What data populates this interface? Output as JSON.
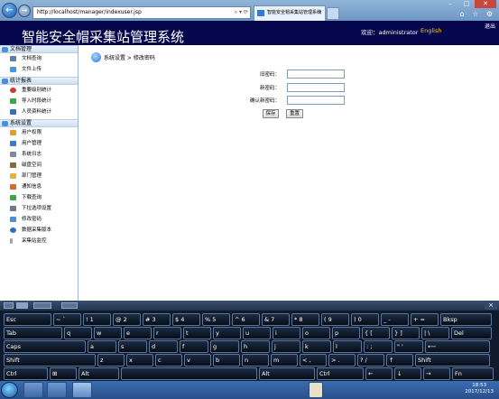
{
  "browser": {
    "url": "http://localhost/manager/indexuser.jsp",
    "tab_title": "智能安全帽采集站管理系统",
    "tab_close": "×"
  },
  "header": {
    "title": "智能安全帽采集站管理系统",
    "welcome": "欢迎：administrator",
    "language": "English",
    "exit": "退出"
  },
  "sidebar": {
    "sections": [
      {
        "title": "文档管理",
        "items": [
          "文档查询",
          "文件上传"
        ]
      },
      {
        "title": "统计报表",
        "items": [
          "重要级别统计",
          "导入时段统计",
          "人员资料统计"
        ]
      },
      {
        "title": "系统设置",
        "items": [
          "用户权限",
          "用户管理",
          "系统日志",
          "磁盘空间",
          "部门管理",
          "通知信息",
          "下载查询",
          "下拉选项设置",
          "修改密码",
          "数据采集版本",
          "采集站监控"
        ]
      }
    ]
  },
  "main": {
    "breadcrumb": "系统设置 > 修改密码",
    "form": {
      "old_password_label": "旧密码：",
      "new_password_label": "新密码：",
      "confirm_password_label": "确认新密码：",
      "save_label": "保存",
      "reset_label": "重置"
    }
  },
  "keyboard": {
    "rows": [
      [
        "Esc",
        "~ `",
        "! 1",
        "@ 2",
        "# 3",
        "$ 4",
        "% 5",
        "^ 6",
        "& 7",
        "* 8",
        "( 9",
        ") 0",
        "_ -",
        "+ =",
        "Bksp"
      ],
      [
        "Tab",
        "q",
        "w",
        "e",
        "r",
        "t",
        "y",
        "u",
        "i",
        "o",
        "p",
        "{ [",
        "} ]",
        "| \\",
        "Del"
      ],
      [
        "Caps",
        "a",
        "s",
        "d",
        "f",
        "g",
        "h",
        "j",
        "k",
        "l",
        ": ;",
        "\" '",
        "⟵"
      ],
      [
        "Shift",
        "z",
        "x",
        "c",
        "v",
        "b",
        "n",
        "m",
        "< ,",
        "> .",
        "? /",
        "↑",
        "Shift"
      ],
      [
        "Ctrl",
        "⊞",
        "Alt",
        "",
        "Alt",
        "Ctrl",
        "←",
        "↓",
        "→",
        "Fn"
      ]
    ],
    "close": "×"
  },
  "taskbar": {
    "time": "18:53",
    "date": "2017/12/13"
  }
}
